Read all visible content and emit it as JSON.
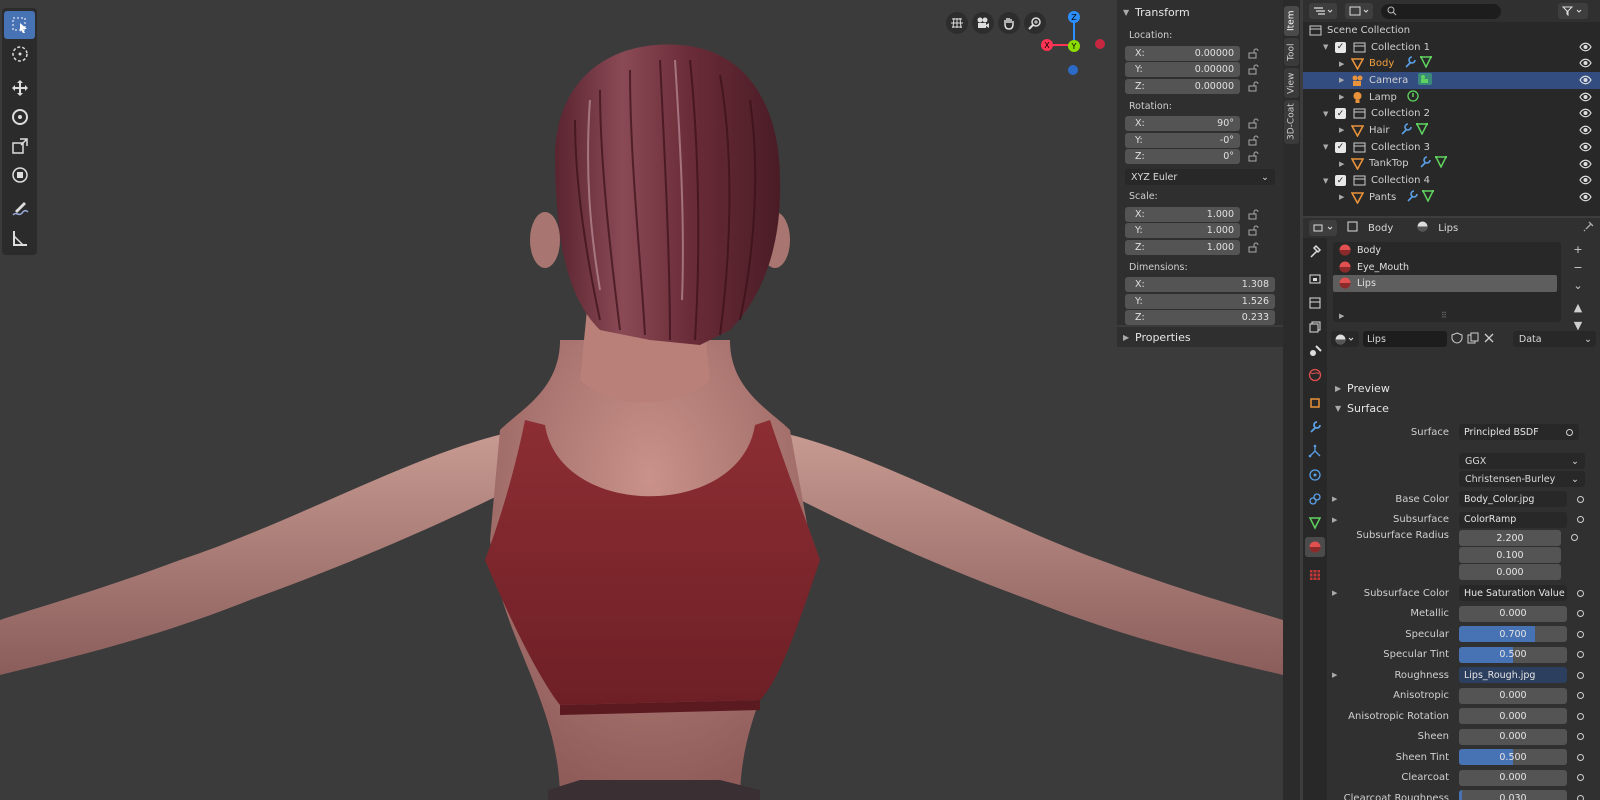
{
  "viewport": {
    "nav_buttons": [
      "grid-icon",
      "camera-icon",
      "hand-pan-icon",
      "zoom-icon"
    ],
    "gizmo": {
      "z": "Z",
      "y": "Y",
      "x": "X"
    }
  },
  "npanel": {
    "transform_label": "Transform",
    "location_label": "Location:",
    "location": {
      "x_label": "X:",
      "x": "0.00000",
      "y_label": "Y:",
      "y": "0.00000",
      "z_label": "Z:",
      "z": "0.00000"
    },
    "rotation_label": "Rotation:",
    "rotation": {
      "x_label": "X:",
      "x": "90°",
      "y_label": "Y:",
      "y": "-0°",
      "z_label": "Z:",
      "z": "0°"
    },
    "rotation_mode": "XYZ Euler",
    "scale_label": "Scale:",
    "scale": {
      "x_label": "X:",
      "x": "1.000",
      "y_label": "Y:",
      "y": "1.000",
      "z_label": "Z:",
      "z": "1.000"
    },
    "dimensions_label": "Dimensions:",
    "dimensions": {
      "x_label": "X:",
      "x": "1.308",
      "y_label": "Y:",
      "y": "1.526",
      "z_label": "Z:",
      "z": "0.233"
    },
    "properties_label": "Properties"
  },
  "sidetabs": [
    "Item",
    "Tool",
    "View",
    "3D-Coat"
  ],
  "outliner": {
    "scene_collection": "Scene Collection",
    "rows": [
      {
        "name": "Collection 1",
        "type": "collection"
      },
      {
        "name": "Body",
        "type": "mesh"
      },
      {
        "name": "Camera",
        "type": "camera"
      },
      {
        "name": "Lamp",
        "type": "light"
      },
      {
        "name": "Collection 2",
        "type": "collection"
      },
      {
        "name": "Hair",
        "type": "mesh"
      },
      {
        "name": "Collection 3",
        "type": "collection"
      },
      {
        "name": "TankTop",
        "type": "mesh"
      },
      {
        "name": "Collection 4",
        "type": "collection"
      },
      {
        "name": "Pants",
        "type": "mesh"
      }
    ]
  },
  "properties": {
    "breadcrumb": {
      "object": "Body",
      "material": "Lips"
    },
    "slots": [
      "Body",
      "Eye_Mouth",
      "Lips"
    ],
    "material_name": "Lips",
    "link_mode": "Data",
    "preview_label": "Preview",
    "surface_section": "Surface",
    "surface": {
      "label": "Surface",
      "value": "Principled BSDF"
    },
    "distribution": "GGX",
    "subsurface_method": "Christensen-Burley",
    "rows": [
      {
        "label": "Base Color",
        "value": "Body_Color.jpg"
      },
      {
        "label": "Subsurface",
        "value": "ColorRamp"
      },
      {
        "label": "Subsurface Radius",
        "values": [
          "2.200",
          "0.100",
          "0.000"
        ]
      },
      {
        "label": "Subsurface Color",
        "value": "Hue Saturation Value"
      },
      {
        "label": "Metallic",
        "value": "0.000",
        "fill": 0
      },
      {
        "label": "Specular",
        "value": "0.700",
        "fill": 0.7
      },
      {
        "label": "Specular Tint",
        "value": "0.500",
        "fill": 0.5
      },
      {
        "label": "Roughness",
        "value": "Lips_Rough.jpg"
      },
      {
        "label": "Anisotropic",
        "value": "0.000",
        "fill": 0
      },
      {
        "label": "Anisotropic Rotation",
        "value": "0.000",
        "fill": 0
      },
      {
        "label": "Sheen",
        "value": "0.000",
        "fill": 0
      },
      {
        "label": "Sheen Tint",
        "value": "0.500",
        "fill": 0.5
      },
      {
        "label": "Clearcoat",
        "value": "0.000",
        "fill": 0
      },
      {
        "label": "Clearcoat Roughness",
        "value": "0.030",
        "fill": 0.03
      }
    ]
  },
  "colors": {
    "accent": "#4772b3",
    "selected_row": "#334d80",
    "mesh_orange": "#e8923a"
  }
}
